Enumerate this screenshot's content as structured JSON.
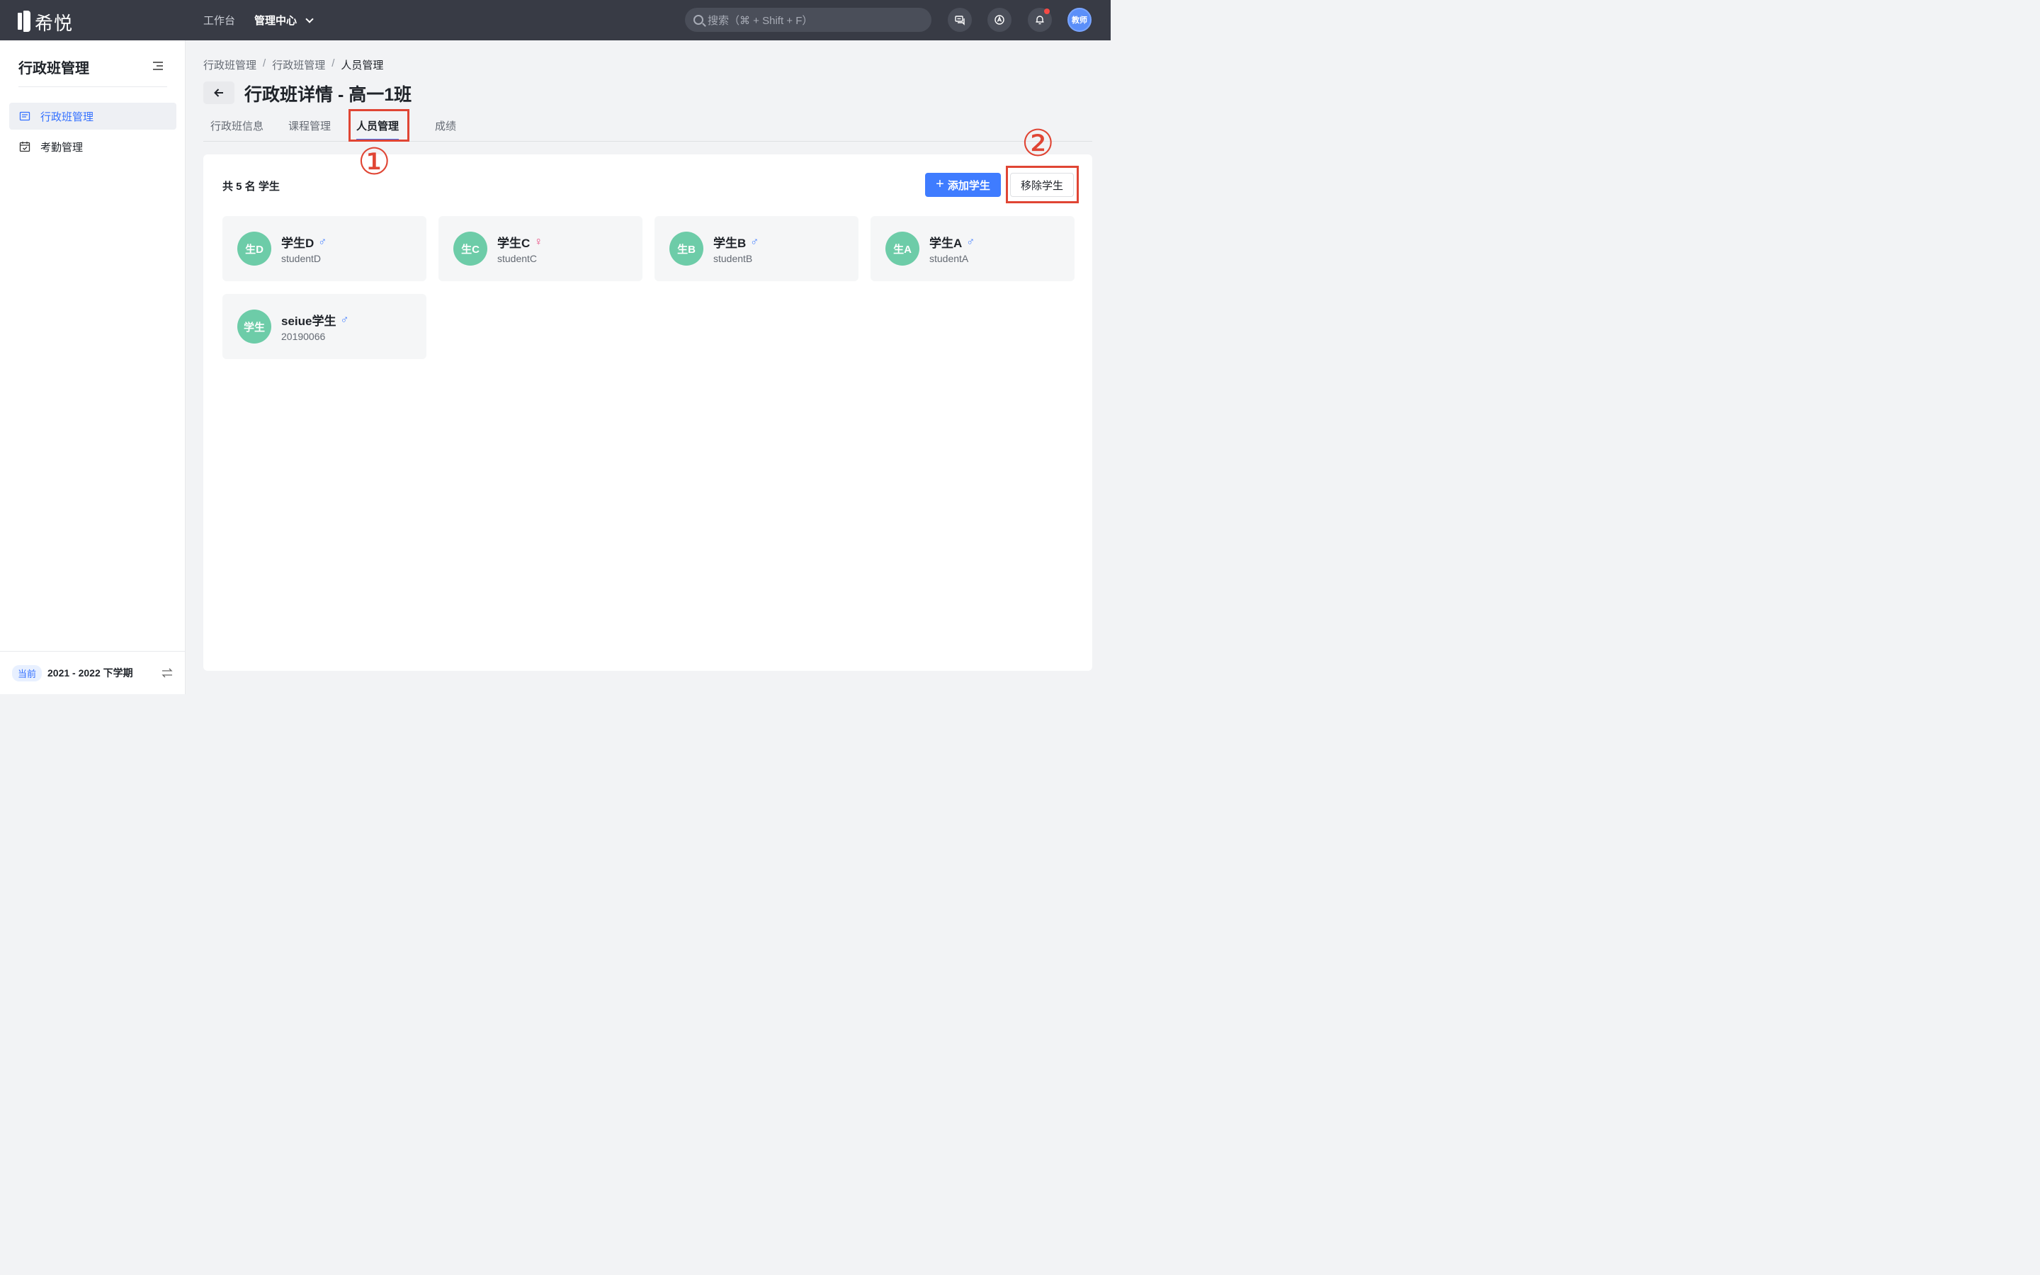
{
  "app": {
    "logo_text": "希悦"
  },
  "topnav": {
    "items": [
      "工作台"
    ],
    "active": "管理中心"
  },
  "search": {
    "placeholder": "搜索（⌘ + Shift + F）"
  },
  "user": {
    "avatar_text": "教师"
  },
  "sidebar": {
    "title": "行政班管理",
    "items": [
      {
        "label": "行政班管理",
        "icon": "class-list-icon",
        "active": true
      },
      {
        "label": "考勤管理",
        "icon": "calendar-check-icon",
        "active": false
      }
    ],
    "term_tag": "当前",
    "term": "2021 - 2022 下学期"
  },
  "breadcrumb": [
    "行政班管理",
    "行政班管理",
    "人员管理"
  ],
  "page_title": "行政班详情 - 高一1班",
  "tabs": [
    "行政班信息",
    "课程管理",
    "人员管理",
    "成绩"
  ],
  "active_tab": "人员管理",
  "annotations": [
    "①",
    "②"
  ],
  "panel": {
    "count_text": "共 5 名 学生",
    "add_label": "添加学生",
    "remove_label": "移除学生",
    "students": [
      {
        "avatar": "生D",
        "name": "学生D",
        "gender": "♂",
        "id": "studentD"
      },
      {
        "avatar": "生C",
        "name": "学生C",
        "gender": "♀",
        "id": "studentC"
      },
      {
        "avatar": "生B",
        "name": "学生B",
        "gender": "♂",
        "id": "studentB"
      },
      {
        "avatar": "生A",
        "name": "学生A",
        "gender": "♂",
        "id": "studentA"
      },
      {
        "avatar": "学生",
        "name": "seiue学生",
        "gender": "♂",
        "id": "20190066"
      }
    ]
  },
  "colors": {
    "accent": "#3f7cff",
    "annotation": "#e04534",
    "avatar": "#6dcca8",
    "topbar": "#383b45"
  }
}
